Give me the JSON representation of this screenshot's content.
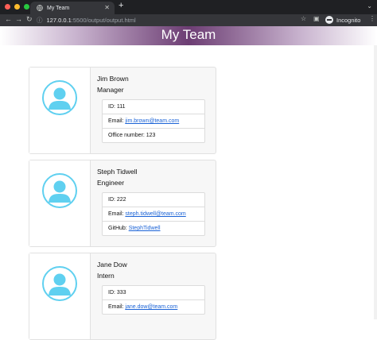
{
  "browser": {
    "tab_title": "My Team",
    "new_tab": "+",
    "url_host": "127.0.0.1",
    "url_path": ":5500/output/output.html",
    "incognito_label": "Incognito",
    "icons": [
      "globe-icon",
      "close-icon",
      "back-icon",
      "forward-icon",
      "reload-icon",
      "star-icon",
      "sidebar-icon",
      "incognito-icon",
      "menu-icon"
    ]
  },
  "page": {
    "title": "My Team",
    "avatar_color": "#5fd0f0"
  },
  "employees": [
    {
      "name": "Jim Brown",
      "role": "Manager",
      "id": "ID: 111",
      "email_label": "Email:",
      "email": "jim.brown@team.com",
      "extra_label": "Office number:",
      "extra_value": "123",
      "extra_is_link": false
    },
    {
      "name": "Steph Tidwell",
      "role": "Engineer",
      "id": "ID: 222",
      "email_label": "Email:",
      "email": "steph.tidwell@team.com",
      "extra_label": "GitHub:",
      "extra_value": "StephTidwell",
      "extra_is_link": true
    },
    {
      "name": "Jane Dow",
      "role": "Intern",
      "id": "ID: 333",
      "email_label": "Email:",
      "email": "jane.dow@team.com",
      "extra_label": "",
      "extra_value": "",
      "extra_is_link": false
    }
  ]
}
